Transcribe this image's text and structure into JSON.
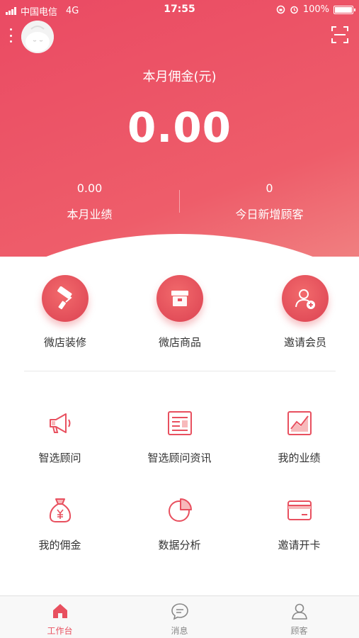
{
  "status_bar": {
    "carrier": "中国电信",
    "network": "4G",
    "time": "17:55",
    "battery": "100%"
  },
  "header": {
    "commission_title": "本月佣金(元)",
    "commission_value": "0.00",
    "stats": [
      {
        "value": "0.00",
        "label": "本月业绩"
      },
      {
        "value": "0",
        "label": "今日新增顾客"
      }
    ]
  },
  "quick_actions": [
    {
      "label": "微店装修",
      "icon": "paint-roller-icon"
    },
    {
      "label": "微店商品",
      "icon": "box-icon"
    },
    {
      "label": "邀请会员",
      "icon": "add-user-icon"
    }
  ],
  "grid": [
    {
      "label": "智选顾问",
      "icon": "megaphone-icon"
    },
    {
      "label": "智选顾问资讯",
      "icon": "news-icon"
    },
    {
      "label": "我的业绩",
      "icon": "trend-chart-icon"
    },
    {
      "label": "我的佣金",
      "icon": "money-bag-icon"
    },
    {
      "label": "数据分析",
      "icon": "pie-chart-icon"
    },
    {
      "label": "邀请开卡",
      "icon": "card-icon"
    }
  ],
  "tabs": [
    {
      "label": "工作台",
      "icon": "home-icon",
      "active": true
    },
    {
      "label": "消息",
      "icon": "message-icon",
      "active": false
    },
    {
      "label": "顾客",
      "icon": "customer-icon",
      "active": false
    }
  ],
  "colors": {
    "accent": "#e8505f",
    "header_gradient_start": "#ea4a63",
    "header_gradient_end": "#f07f80",
    "icon_stroke": "#e8505f"
  }
}
